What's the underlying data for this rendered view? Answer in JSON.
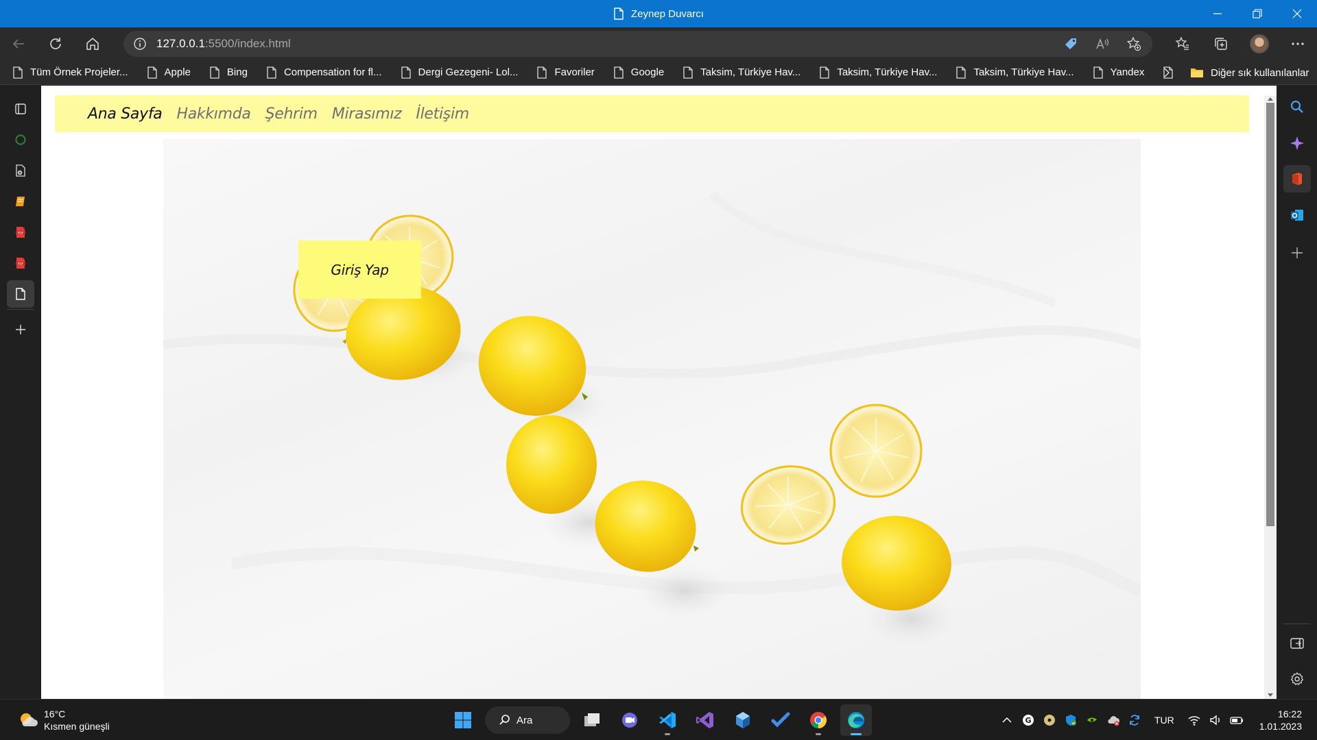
{
  "window": {
    "title": "Zeynep Duvarcı"
  },
  "address": {
    "host": "127.0.0.1",
    "rest": ":5500/index.html"
  },
  "favorites": [
    {
      "label": "Tüm Örnek Projeler..."
    },
    {
      "label": "Apple"
    },
    {
      "label": "Bing"
    },
    {
      "label": "Compensation for fl..."
    },
    {
      "label": "Dergi Gezegeni- Lol..."
    },
    {
      "label": "Favoriler"
    },
    {
      "label": "Google"
    },
    {
      "label": "Taksim, Türkiye Hav..."
    },
    {
      "label": "Taksim, Türkiye Hav..."
    },
    {
      "label": "Taksim, Türkiye Hav..."
    },
    {
      "label": "Yandex"
    },
    {
      "label": ""
    }
  ],
  "favorites_other": "Diğer sık kullanılanlar",
  "site": {
    "nav": [
      {
        "label": "Ana Sayfa",
        "current": true
      },
      {
        "label": "Hakkımda",
        "current": false
      },
      {
        "label": "Şehrim",
        "current": false
      },
      {
        "label": "Mirasımız",
        "current": false
      },
      {
        "label": "İletişim",
        "current": false
      }
    ],
    "login_label": "Giriş Yap",
    "nav_bg": "#fefb9f",
    "button_bg": "#fefb7a",
    "hero_image": "lemons-on-white-cloth"
  },
  "taskbar": {
    "weather_temp": "16°C",
    "weather_desc": "Kısmen güneşli",
    "search_label": "Ara",
    "language": "TUR",
    "time": "16:22",
    "date": "1.01.2023"
  },
  "colors": {
    "titlebar": "#0a74cf",
    "chrome": "#2b2b2b",
    "accent": "#4cc2ff"
  }
}
